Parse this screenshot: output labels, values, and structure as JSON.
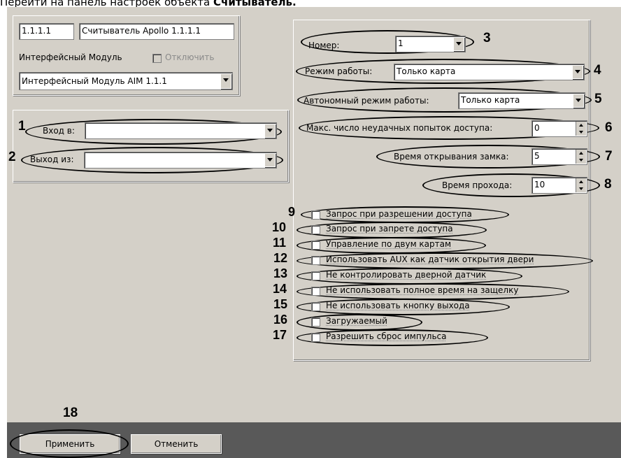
{
  "caption": {
    "text": "Перейти на панель настроек объекта ",
    "bold": "Считыватель."
  },
  "header": {
    "id_value": "1.1.1.1",
    "name_value": "Считыватель Apollo 1.1.1.1",
    "interface_label": "Интерфейсный Модуль",
    "disable_label": "Отключить",
    "interface_value": "Интерфейсный Модуль AIM 1.1.1"
  },
  "left": {
    "input_label": "Вход в:",
    "input_value": "",
    "output_label": "Выход из:",
    "output_value": ""
  },
  "right": {
    "number_label": "Номер:",
    "number_value": "1",
    "mode_label": "Режим работы:",
    "mode_value": "Только карта",
    "auto_label": "Автономный режим работы:",
    "auto_value": "Только карта",
    "max_label": "Макс. число неудачных попыток доступа:",
    "max_value": "0",
    "lock_label": "Время открывания замка:",
    "lock_value": "5",
    "pass_label": "Время прохода:",
    "pass_value": "10"
  },
  "checkboxes": [
    "Запрос при разрешении доступа",
    "Запрос при запрете доступа",
    "Управление по двум картам",
    "Использовать AUX как датчик открытия двери",
    "Не контролировать дверной датчик",
    "Не использовать полное время на защелку",
    "Не использовать кнопку выхода",
    "Загружаемый",
    "Разрешить сброс импульса"
  ],
  "numbers": [
    "1",
    "2",
    "3",
    "4",
    "5",
    "6",
    "7",
    "8",
    "9",
    "10",
    "11",
    "12",
    "13",
    "14",
    "15",
    "16",
    "17",
    "18"
  ],
  "buttons": {
    "apply": "Применить",
    "cancel": "Отменить"
  }
}
